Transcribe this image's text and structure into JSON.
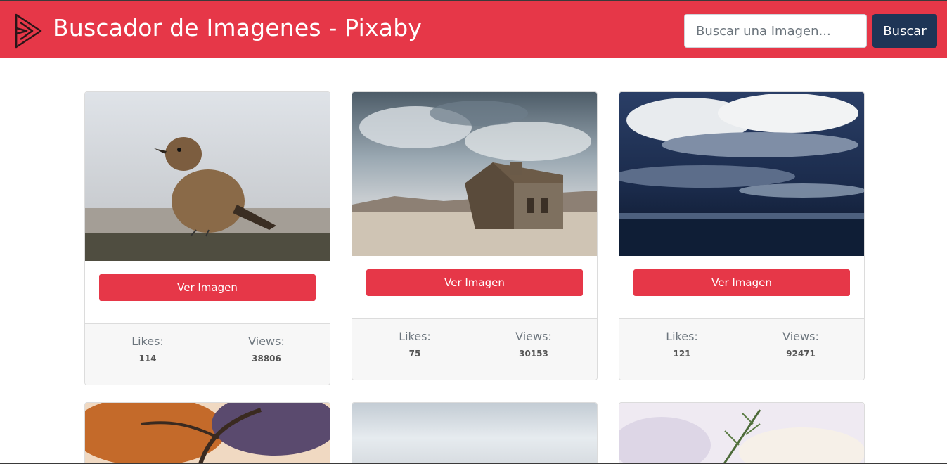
{
  "header": {
    "title": "Buscador de Imagenes - Pixaby",
    "search_placeholder": "Buscar una Imagen...",
    "search_value": "",
    "search_button": "Buscar",
    "brand_color": "#e63748",
    "button_color": "#1e3556"
  },
  "cards": [
    {
      "image": "bird-photo",
      "button": "Ver Imagen",
      "likes_label": "Likes:",
      "likes": "114",
      "views_label": "Views:",
      "views": "38806"
    },
    {
      "image": "wooden-house-photo",
      "button": "Ver Imagen",
      "likes_label": "Likes:",
      "likes": "75",
      "views_label": "Views:",
      "views": "30153"
    },
    {
      "image": "storm-clouds-photo",
      "button": "Ver Imagen",
      "likes_label": "Likes:",
      "likes": "121",
      "views_label": "Views:",
      "views": "92471"
    },
    {
      "image": "autumn-tree-photo"
    },
    {
      "image": "misty-landscape-photo"
    },
    {
      "image": "frosty-branch-photo"
    }
  ]
}
